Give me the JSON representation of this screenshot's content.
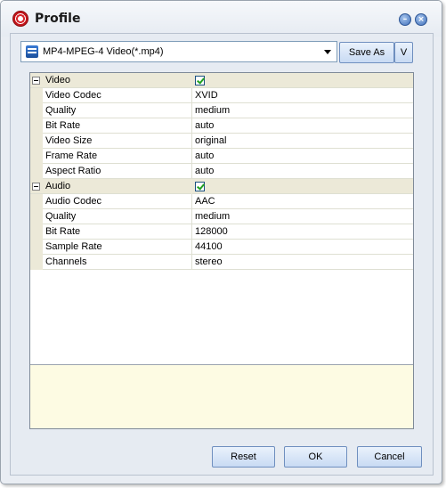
{
  "window": {
    "title": "Profile"
  },
  "title_buttons": {
    "minimize": "–",
    "close": "×"
  },
  "format": {
    "selected": "MP4-MPEG-4 Video(*.mp4)"
  },
  "toolbar": {
    "save_as": "Save As",
    "v": "V"
  },
  "properties": {
    "video": {
      "label": "Video",
      "enabled": true,
      "rows": [
        {
          "name": "Video Codec",
          "value": "XVID"
        },
        {
          "name": "Quality",
          "value": "medium"
        },
        {
          "name": "Bit Rate",
          "value": "auto"
        },
        {
          "name": "Video Size",
          "value": "original"
        },
        {
          "name": "Frame Rate",
          "value": "auto"
        },
        {
          "name": "Aspect Ratio",
          "value": "auto"
        }
      ]
    },
    "audio": {
      "label": "Audio",
      "enabled": true,
      "rows": [
        {
          "name": "Audio Codec",
          "value": "AAC"
        },
        {
          "name": "Quality",
          "value": "medium"
        },
        {
          "name": "Bit Rate",
          "value": "128000"
        },
        {
          "name": "Sample Rate",
          "value": "44100"
        },
        {
          "name": "Channels",
          "value": "stereo"
        }
      ]
    }
  },
  "footer": {
    "reset": "Reset",
    "ok": "OK",
    "cancel": "Cancel"
  }
}
